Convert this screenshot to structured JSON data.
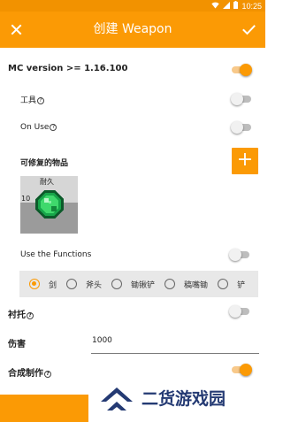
{
  "status_bar": {
    "time": "10:25"
  },
  "app_bar": {
    "title": "创建 Weapon"
  },
  "settings": {
    "mc_version": {
      "label": "MC version >= 1.16.100",
      "on": true
    },
    "tool": {
      "label": "工具",
      "on": false
    },
    "on_use": {
      "label": "On Use",
      "on": false
    },
    "repair_items": {
      "label": "可修复的物品",
      "add_label": "+"
    },
    "item_tile": {
      "durability_label": "耐久",
      "count": "10"
    },
    "use_functions": {
      "label": "Use the Functions",
      "on": false
    },
    "function_options": [
      "剑",
      "斧头",
      "锄锹铲",
      "稿嘴锄",
      "铲"
    ],
    "selected_function": "剑",
    "backing": {
      "label": "衬托",
      "on": false
    },
    "damage": {
      "label": "伤害",
      "value": "1000"
    },
    "crafting": {
      "label": "合成制作",
      "on": true
    }
  },
  "watermark": {
    "text": "二货游戏园"
  },
  "colors": {
    "accent": "#fb9a05",
    "status_bar": "#f29200",
    "watermark": "#243a73"
  }
}
